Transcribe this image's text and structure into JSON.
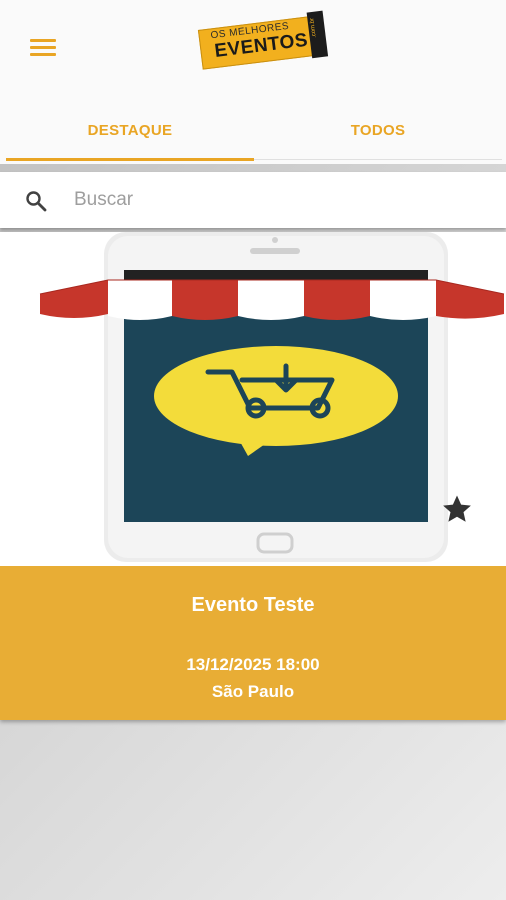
{
  "header": {
    "logo_top": "OS MELHORES",
    "logo_main": "EVENTOS",
    "logo_domain": ".com.br"
  },
  "tabs": [
    {
      "label": "DESTAQUE",
      "active": true
    },
    {
      "label": "TODOS",
      "active": false
    }
  ],
  "search": {
    "placeholder": "Buscar",
    "value": ""
  },
  "events": [
    {
      "title": "Evento Teste",
      "datetime": "13/12/2025 18:00",
      "location": "São Paulo",
      "favorite_icon": "star-icon"
    }
  ],
  "colors": {
    "accent": "#e9a524",
    "card_info_bg": "#e8ad35",
    "app_bar_bg": "#fafafa"
  }
}
